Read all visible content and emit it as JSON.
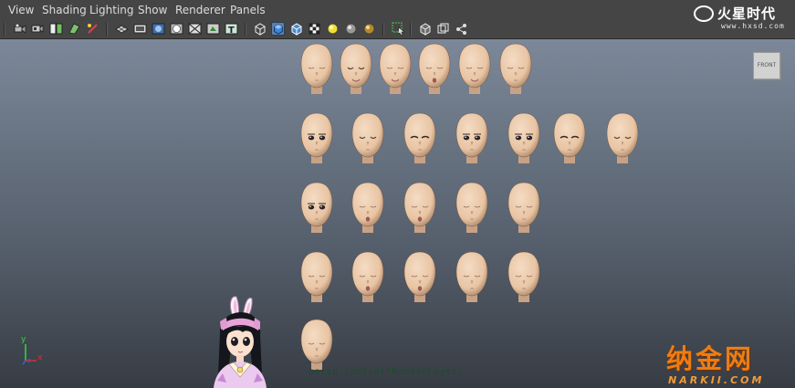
{
  "menu": {
    "items": [
      "View",
      "Shading",
      "Lighting",
      "Show",
      "Renderer",
      "Panels"
    ]
  },
  "toolbar": {
    "groups": [
      [
        "camera-attributes-icon",
        "bookmark-icon",
        "image-plane-icon",
        "2d-pan-zoom-icon",
        "grease-pencil-icon"
      ],
      [
        "grid-icon",
        "film-gate-icon",
        "resolution-gate-icon",
        "gate-mask-icon",
        "field-chart-icon",
        "safe-action-icon",
        "safe-title-icon"
      ],
      [
        "wireframe-icon",
        "smooth-shade-icon",
        "wireframe-on-shaded-icon",
        "textured-icon",
        "use-all-lights-icon",
        "shadows-icon",
        "ambient-occlusion-icon"
      ],
      [
        "isolate-select-icon",
        "xray-icon",
        "xray-joints-icon",
        "xray-components-icon"
      ]
    ]
  },
  "brand": {
    "name": "火星时代",
    "url": "www.hxsd.com"
  },
  "viewport": {
    "view_cube_label": "FRONT",
    "camera_label": "persp (defaultRenderLayer)",
    "axis": {
      "x": "x",
      "y": "y",
      "z": "z"
    }
  },
  "heads": {
    "rows": [
      [
        "blank",
        "closed-smile",
        "smile-open",
        "mouth-o",
        "smile",
        "calm"
      ],
      [
        "eyes-open",
        "eyes-closed",
        "eyes-wink",
        "eyes-open-calm",
        "eyes-angry",
        "eyes-squint",
        "eyes-happy-closed"
      ],
      [
        "eyes-wide",
        "mouth-round",
        "mouth-o-small",
        "neutral",
        "neutral-2"
      ],
      [
        "blank-2",
        "mouth-o-2",
        "mouth-open-2",
        "neutral-3",
        "neutral-4"
      ],
      [
        "blank-3"
      ]
    ]
  },
  "watermark": {
    "main": "纳金网",
    "sub": "NARKII.COM"
  },
  "colors": {
    "menubar_bg": "#454545",
    "menu_text": "#dcdcdc",
    "skin": "#e8c4a3",
    "viewport_top": "#7c8899",
    "viewport_bottom": "#373c44",
    "camera_label": "#1c4d2a",
    "watermark": "#ef7c12",
    "axis_x": "#d83030",
    "axis_y": "#2fd842",
    "axis_z": "#3060e8"
  }
}
